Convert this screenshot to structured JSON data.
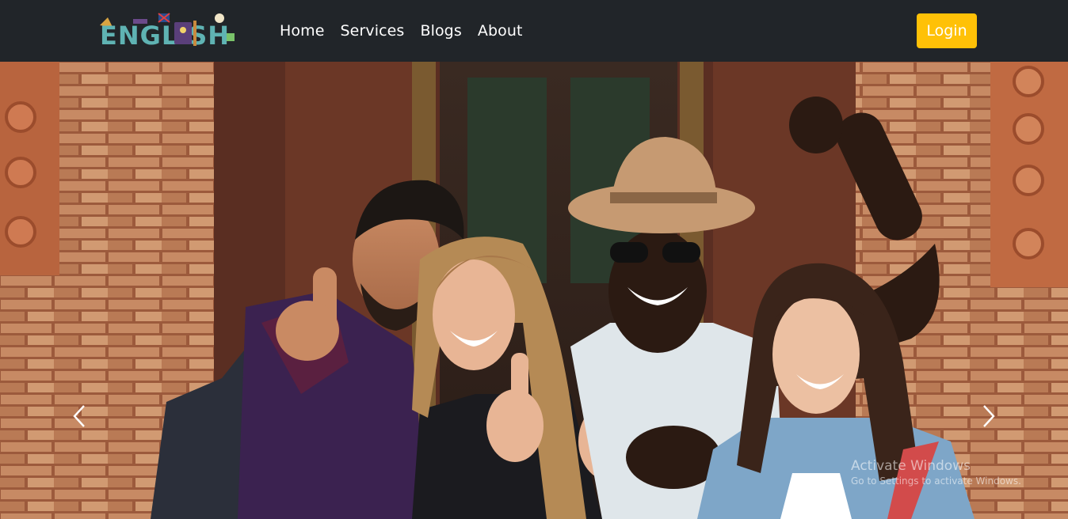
{
  "brand": {
    "logo_text": "ENGLISH"
  },
  "nav": {
    "items": [
      {
        "label": "Home"
      },
      {
        "label": "Services"
      },
      {
        "label": "Blogs"
      },
      {
        "label": "About"
      }
    ],
    "login_label": "Login"
  },
  "hero": {
    "image_subject": "four smiling students in front of a brick building",
    "prev_icon": "chevron-left-icon",
    "next_icon": "chevron-right-icon"
  },
  "watermark": {
    "title": "Activate Windows",
    "subtitle": "Go to Settings to activate Windows."
  },
  "colors": {
    "navbar_bg": "#212529",
    "login_bg": "#ffc107",
    "logo_teal": "#5fb3b3"
  }
}
